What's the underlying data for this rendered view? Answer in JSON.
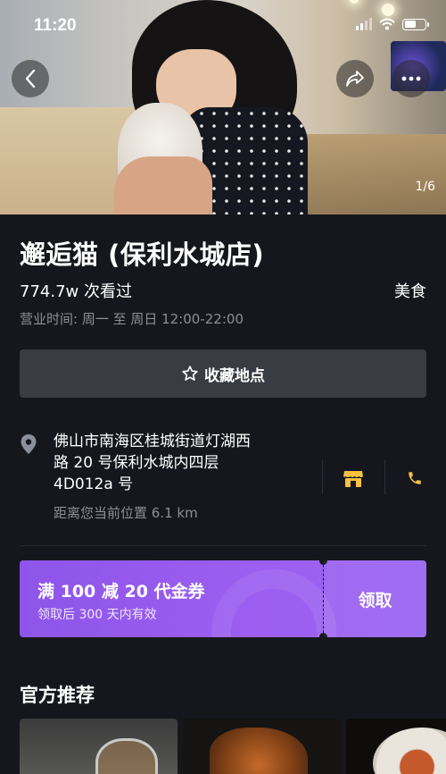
{
  "status": {
    "time": "11:20"
  },
  "hero": {
    "photo_counter": "1/6"
  },
  "place": {
    "name": "邂逅猫 (保利水城店)",
    "views": "774.7w 次看过",
    "category": "美食",
    "hours": "营业时间: 周一 至 周日  12:00-22:00",
    "favorite_label": "收藏地点",
    "address_lines": [
      "佛山市南海区桂城街道灯湖西",
      "路 20 号保利水城内四层",
      "4D012a 号"
    ],
    "distance": "距离您当前位置 6.1 km"
  },
  "coupon": {
    "title": "满 100 减 20 代金券",
    "subtitle": "领取后 300 天内有效",
    "claim_label": "领取"
  },
  "recommend": {
    "title": "官方推荐"
  },
  "colors": {
    "background": "#15171c",
    "accent_purple": "#9b5ff0",
    "icon_yellow": "#f5c242"
  }
}
